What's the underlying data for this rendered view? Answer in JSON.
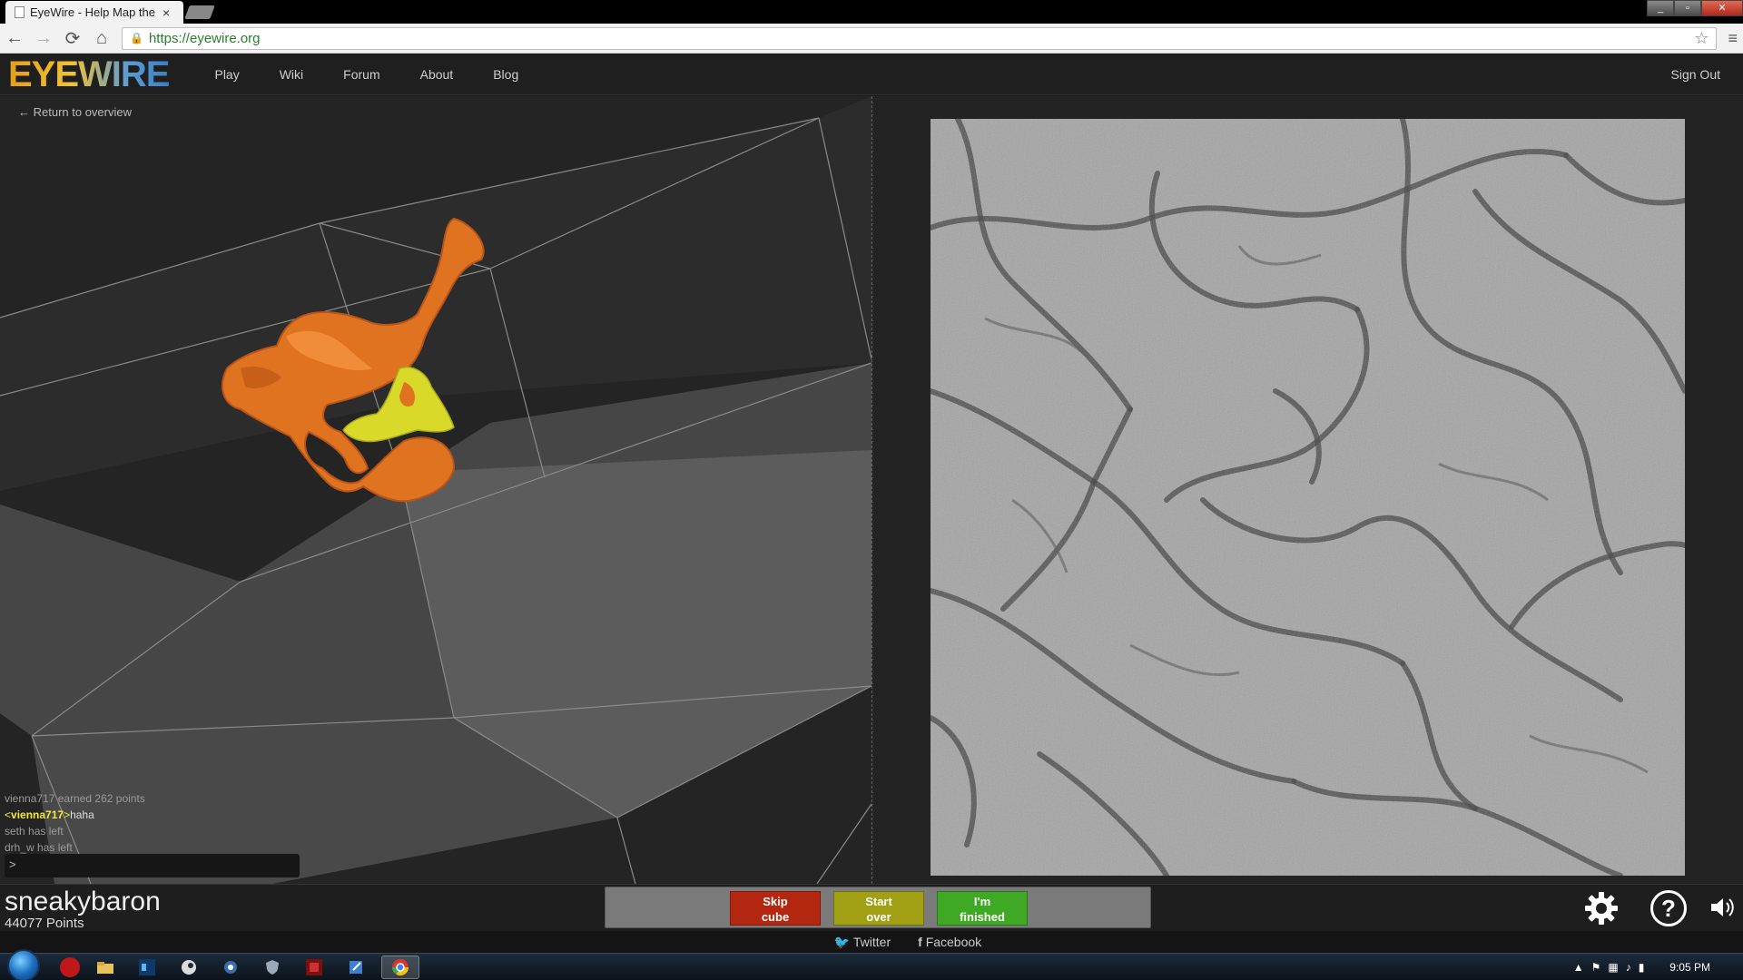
{
  "browser": {
    "tab_title": "EyeWire - Help Map the R",
    "tab_close": "×",
    "url": "https://eyewire.org",
    "lock_symbol": "🔒",
    "nav": {
      "back": "←",
      "forward": "→",
      "reload": "⟳",
      "home": "⌂",
      "star": "☆",
      "menu": "≡"
    },
    "window_buttons": {
      "minimize": "_",
      "maximize": "▫",
      "close": "✕"
    }
  },
  "site": {
    "logo": "EYEWIRE",
    "nav": [
      "Play",
      "Wiki",
      "Forum",
      "About",
      "Blog"
    ],
    "sign_out": "Sign Out"
  },
  "workspace": {
    "return_link": "← Return to overview",
    "chat": {
      "line1": "vienna717 earned 262 points",
      "line2_open": "<",
      "line2_user": "vienna717",
      "line2_close": ">",
      "line2_msg": "haha",
      "line3": "seth has left",
      "line4": "drh_w has left",
      "input_prompt": ">"
    }
  },
  "player": {
    "username": "sneakybaron",
    "points": "44077 Points"
  },
  "actions": {
    "skip": [
      "Skip",
      "cube"
    ],
    "start": [
      "Start",
      "over"
    ],
    "finish": [
      "I'm",
      "finished"
    ]
  },
  "controls": {
    "help": "?"
  },
  "social": {
    "twitter": "Twitter",
    "facebook": "Facebook",
    "twitter_icon": "🐦",
    "facebook_icon": "f"
  },
  "taskbar": {
    "clock": "9:05 PM",
    "icons": [
      "opera-icon",
      "folder-icon",
      "photoshop-icon",
      "steam-icon",
      "app-icon",
      "shield-icon",
      "game-icon",
      "note-icon",
      "chrome-icon"
    ]
  },
  "colors": {
    "accent_orange": "#e8761f",
    "segment_yellow": "#d9d92a",
    "skip_red": "#b3260f",
    "start_yellow": "#a19f14",
    "finish_green": "#3fa824"
  }
}
